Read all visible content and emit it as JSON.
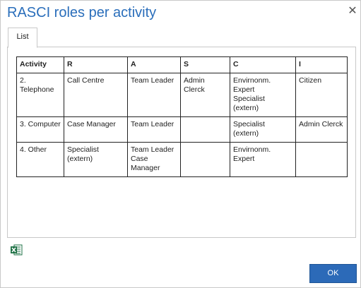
{
  "dialog": {
    "title": "RASCI roles per activity",
    "close_glyph": "✕"
  },
  "tabs": [
    {
      "label": "List"
    }
  ],
  "table": {
    "headers": [
      "Activity",
      "R",
      "A",
      "S",
      "C",
      "I"
    ],
    "rows": [
      [
        "2. Telephone",
        "Call Centre",
        "Team Leader",
        "Admin Clerck",
        "Envirnonm. Expert\nSpecialist (extern)",
        "Citizen"
      ],
      [
        "3. Computer",
        "Case Manager",
        "Team Leader",
        "",
        "Specialist (extern)",
        "Admin Clerck"
      ],
      [
        "4. Other",
        "Specialist (extern)",
        "Team Leader\nCase Manager",
        "",
        "Envirnonm. Expert",
        ""
      ]
    ]
  },
  "footer": {
    "export_icon": "excel-icon",
    "ok_label": "OK"
  },
  "colors": {
    "title": "#2a6ebb",
    "ok_button": "#2c6ab8",
    "border": "#c8c8c8",
    "excel_green": "#1e7145"
  }
}
